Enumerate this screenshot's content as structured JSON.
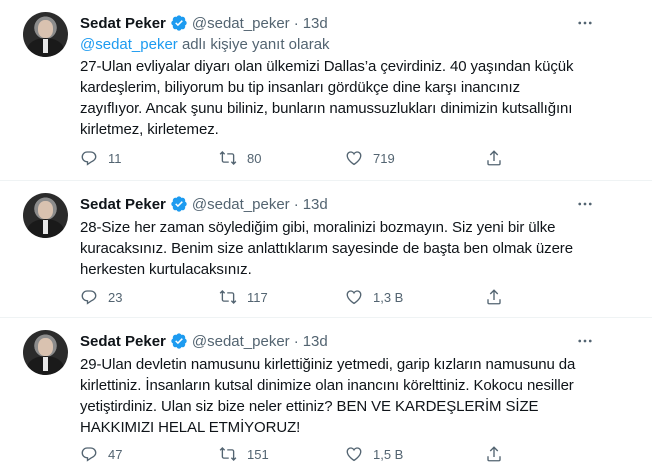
{
  "tweets": [
    {
      "author": {
        "name": "Sedat Peker",
        "handle": "@sedat_peker",
        "verified": true
      },
      "separator": "·",
      "time": "13d",
      "reply_to": {
        "mention": "@sedat_peker",
        "suffix": " adlı kişiye yanıt olarak"
      },
      "lines": [
        "27-Ulan evliyalar diyarı olan ülkemizi Dallas’a çevirdiniz. 40 yaşından küçük",
        "kardeşlerim, biliyorum bu tip insanları gördükçe dine karşı inancınız",
        "zayıflıyor. Ancak şunu biliniz, bunların namussuzlukları dinimizin kutsallığını",
        "kirletmez, kirletemez."
      ],
      "stats": {
        "replies": "11",
        "retweets": "80",
        "likes": "719"
      }
    },
    {
      "author": {
        "name": "Sedat Peker",
        "handle": "@sedat_peker",
        "verified": true
      },
      "separator": "·",
      "time": "13d",
      "lines": [
        "28-Size her zaman söylediğim gibi, moralinizi bozmayın. Siz yeni bir ülke",
        "kuracaksınız. Benim size anlattıklarım sayesinde de başta ben olmak üzere",
        "herkesten kurtulacaksınız."
      ],
      "stats": {
        "replies": "23",
        "retweets": "117",
        "likes": "1,3 B"
      }
    },
    {
      "author": {
        "name": "Sedat Peker",
        "handle": "@sedat_peker",
        "verified": true
      },
      "separator": "·",
      "time": "13d",
      "lines": [
        "29-Ulan devletin namusunu kirlettiğiniz yetmedi, garip kızların namusunu da",
        "kirlettiniz. İnsanların kutsal dinimize olan inancını körelttiniz. Kokocu nesiller",
        "yetiştirdiniz. Ulan siz bize neler ettiniz? BEN VE KARDEŞLERİM SİZE",
        "HAKKIMIZI HELAL ETMİYORUZ!"
      ],
      "stats": {
        "replies": "47",
        "retweets": "151",
        "likes": "1,5 B"
      }
    }
  ],
  "colors": {
    "accent": "#1d9bf0",
    "secondary_text": "#536471",
    "primary_text": "#0f1419",
    "divider": "#eff3f4"
  },
  "icons": {
    "reply": "reply-icon",
    "retweet": "retweet-icon",
    "like": "heart-icon",
    "share": "share-icon",
    "more": "more-icon",
    "verified": "verified-badge-icon"
  }
}
